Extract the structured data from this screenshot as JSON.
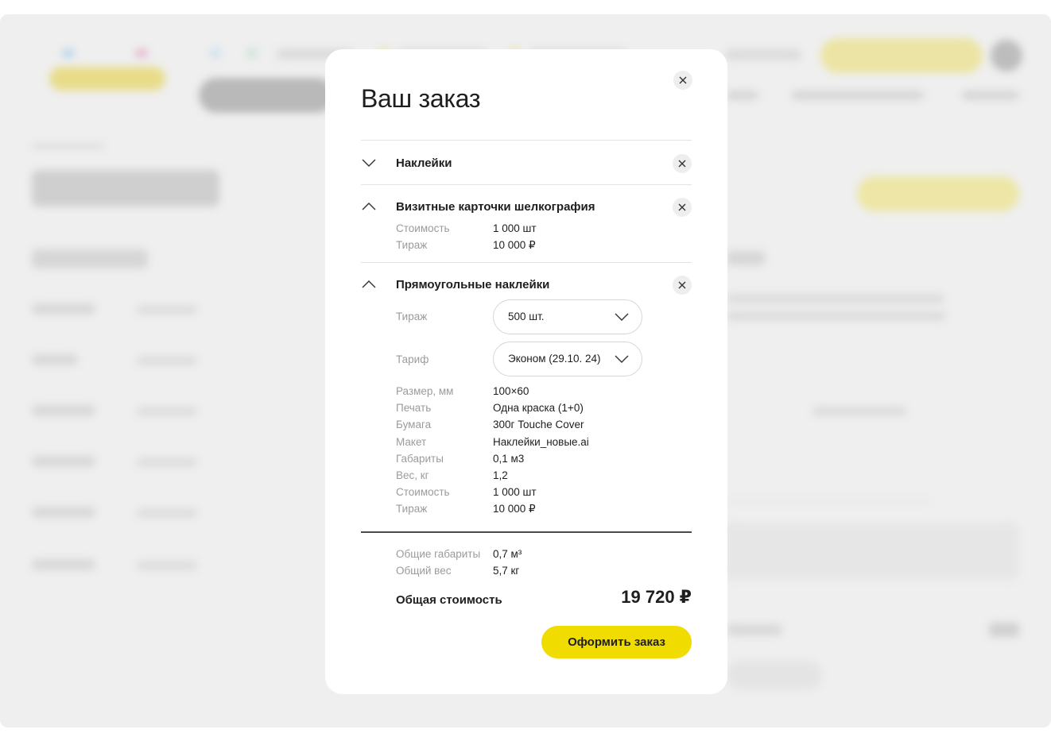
{
  "modal": {
    "title": "Ваш заказ",
    "sections": [
      {
        "name": "Наклейки",
        "expanded": false
      },
      {
        "name": "Визитные карточки шелкография",
        "expanded": true,
        "details": [
          {
            "label": "Стоимость",
            "value": "1 000 шт"
          },
          {
            "label": "Тираж",
            "value": "10 000 ₽"
          }
        ]
      },
      {
        "name": "Прямоугольные наклейки",
        "expanded": true,
        "selects": [
          {
            "label": "Тираж",
            "value": "500 шт."
          },
          {
            "label": "Тариф",
            "value": "Эконом (29.10. 24)"
          }
        ],
        "details": [
          {
            "label": "Размер, мм",
            "value": "100×60"
          },
          {
            "label": "Печать",
            "value": "Одна краска (1+0)"
          },
          {
            "label": "Бумага",
            "value": "300г Touche Cover"
          },
          {
            "label": "Макет",
            "value": "Наклейки_новые.ai"
          },
          {
            "label": "Габариты",
            "value": "0,1 м3"
          },
          {
            "label": "Вес, кг",
            "value": "1,2"
          },
          {
            "label": "Стоимость",
            "value": "1 000 шт"
          },
          {
            "label": "Тираж",
            "value": "10 000 ₽"
          }
        ]
      }
    ],
    "summary": [
      {
        "label": "Общие габариты",
        "value": "0,7 м³"
      },
      {
        "label": "Общий вес",
        "value": "5,7 кг"
      }
    ],
    "total_label": "Общая стоимость",
    "total_price": "19 720 ₽",
    "order_button": "Оформить заказ"
  },
  "icons": {
    "close": "close-icon",
    "collapse": "chevron-up-icon",
    "expand": "chevron-down-icon",
    "dropdown": "chevron-down-icon"
  },
  "colors": {
    "accent": "#f1dc00",
    "overlay_bg": "#efefef",
    "muted_text": "#9b9b9b"
  }
}
